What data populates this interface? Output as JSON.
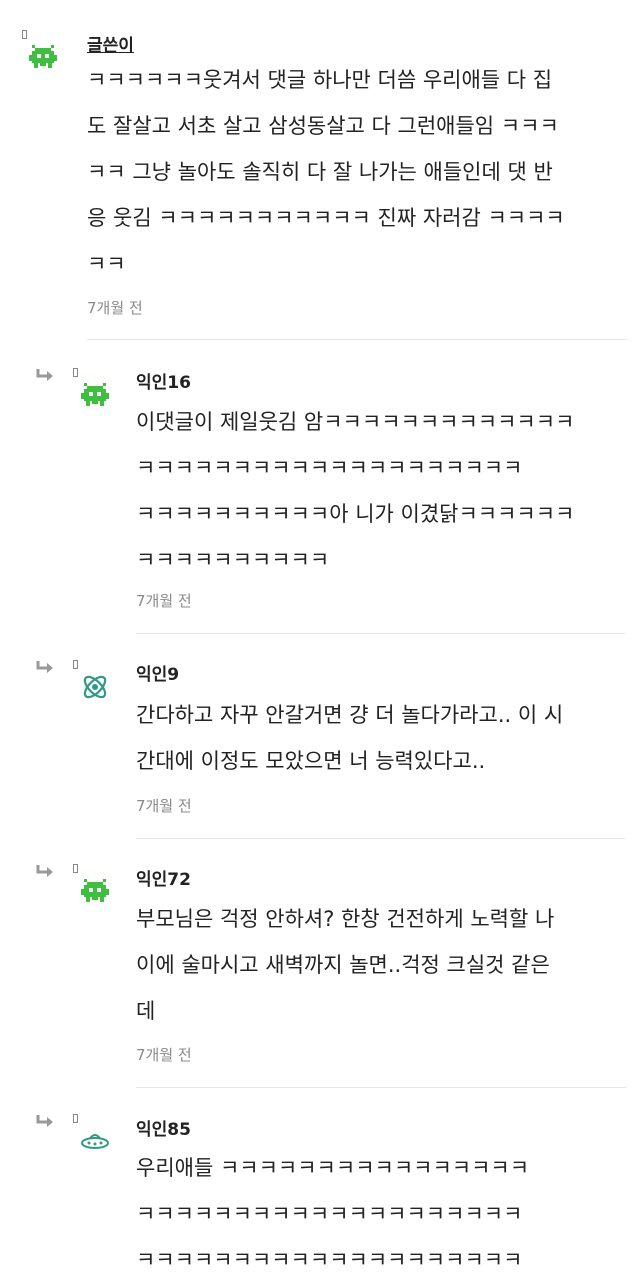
{
  "post_comment": {
    "author": "글쓴이",
    "text_lines": [
      "ㅋㅋㅋㅋㅋㅋ웃겨서 댓글 하나만 더씀 우리애들 다 집",
      "도 잘살고 서초 살고 삼성동살고 다 그런애들임 ㅋㅋㅋ",
      "ㅋㅋ 그냥 놀아도 솔직히 다 잘 나가는 애들인데 댓 반",
      "응 웃김 ㅋㅋㅋㅋㅋㅋㅋㅋㅋㅋㅋ 진짜 자러감 ㅋㅋㅋㅋ",
      "ㅋㅋ"
    ],
    "time": "7개월 전",
    "avatar_icon": "space-invader-icon"
  },
  "replies": [
    {
      "author": "익인16",
      "text_lines": [
        "이댓글이 제일웃김 암ㅋㅋㅋㅋㅋㅋㅋㅋㅋㅋㅋㅋㅋ",
        "ㅋㅋㅋㅋㅋㅋㅋㅋㅋㅋㅋㅋㅋㅋㅋㅋㅋㅋㅋㅋ",
        "ㅋㅋㅋㅋㅋㅋㅋㅋㅋㅋ아 니가 이겼닭ㅋㅋㅋㅋㅋㅋ",
        "ㅋㅋㅋㅋㅋㅋㅋㅋㅋㅋ"
      ],
      "time": "7개월 전",
      "avatar_icon": "space-invader-icon"
    },
    {
      "author": "익인9",
      "text_lines": [
        "간다하고 자꾸 안갈거면 걍 더 놀다가라고.. 이 시",
        "간대에 이정도 모았으면 너 능력있다고.."
      ],
      "time": "7개월 전",
      "avatar_icon": "atom-icon"
    },
    {
      "author": "익인72",
      "text_lines": [
        "부모님은 걱정 안하셔? 한창 건전하게 노력할 나",
        "이에 술마시고 새벽까지 놀면..걱정 크실것 같은",
        "데"
      ],
      "time": "7개월 전",
      "avatar_icon": "space-invader-icon"
    },
    {
      "author": "익인85",
      "text_lines": [
        "우리애들 ㅋㅋㅋㅋㅋㅋㅋㅋㅋㅋㅋㅋㅋㅋㅋㅋ",
        "ㅋㅋㅋㅋㅋㅋㅋㅋㅋㅋㅋㅋㅋㅋㅋㅋㅋㅋㅋㅋ",
        "ㅋㅋㅋㅋㅋㅋㅋㅋㅋㅋㅋㅋㅋㅋㅋㅋㅋㅋㅋㅋ"
      ],
      "time": "",
      "avatar_icon": "ufo-icon"
    }
  ],
  "colors": {
    "avatar_green": "#3fbf3f",
    "avatar_teal": "#2f9a85",
    "time_gray": "#8a8a8a",
    "divider": "#e6e6e6"
  }
}
